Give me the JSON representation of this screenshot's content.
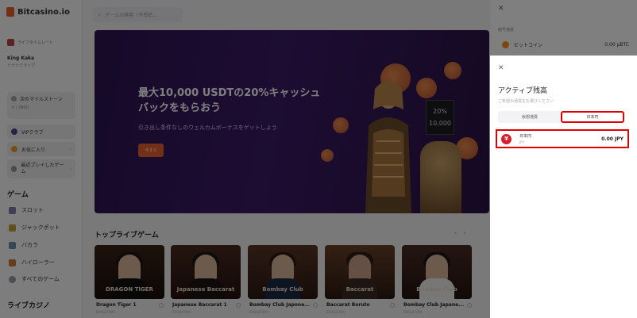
{
  "sidebar": {
    "brand": "Bitcasino.io",
    "vip_label": "ライフタイムレート",
    "user_name": "King Kaka",
    "user_sub": "バナナクラップ",
    "milestone_title": "次のマイルストーン",
    "milestone_value": "0 / 3800",
    "nav": [
      "VIPクラブ",
      "お気に入り",
      "最近プレイしたゲーム"
    ],
    "games_header": "ゲーム",
    "games": [
      "スロット",
      "ジャックポット",
      "バカラ",
      "ハイローラー",
      "すべてのゲーム"
    ],
    "live_header": "ライブカジノ"
  },
  "search": {
    "placeholder": "ゲームの検索（予想名..."
  },
  "banner": {
    "title": "最大10,000 USDTの20%キャッシュバックをもらおう",
    "subtitle": "引き出し条件なしのウェルカムボーナスをゲットしよう",
    "cta": "今すぐ",
    "sign_top": "20%",
    "sign_bottom": "10,000"
  },
  "top_games": {
    "header": "トップライブゲーム",
    "prev": "‹",
    "next": "›",
    "cards": [
      {
        "logo": "DRAGON TIGER",
        "name": "Dragon Tiger 1",
        "sub": "EVOLUTION"
      },
      {
        "logo": "Japanese Baccarat",
        "name": "Japanese Baccarat 1",
        "sub": "EVOLUTION"
      },
      {
        "logo": "Bombay Club",
        "name": "Bombay Club Japone...",
        "sub": "EVOLUTION"
      },
      {
        "logo": "Baccarat",
        "name": "Baccarat Boruto",
        "sub": "EVOLUTION"
      },
      {
        "logo": "Bombay Club",
        "name": "Bombay Club Japane...",
        "sub": "EVOLUTION"
      }
    ]
  },
  "drawer": {
    "label": "暗号通貨",
    "btc_name": "ビットコイン",
    "btc_amount": "0.00 μBTC"
  },
  "modal": {
    "title": "アクティブ残高",
    "subtitle": "ご希望の通貨をお選びください",
    "tab_crypto": "仮想通貨",
    "tab_fiat": "日本円",
    "currency_symbol": "¥",
    "currency_name": "日本円",
    "currency_code": "JPY",
    "currency_amount": "0.00 JPY"
  },
  "colors": {
    "accent": "#e8612c",
    "highlight": "#e00000",
    "yen": "#d81e2c"
  }
}
